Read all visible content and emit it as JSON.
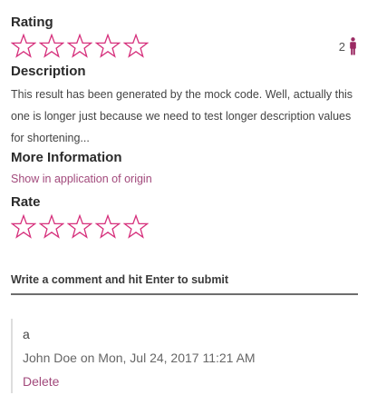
{
  "rating": {
    "heading": "Rating",
    "stars_filled": 0,
    "stars_total": 5,
    "count": "2",
    "count_icon": "person-icon"
  },
  "description": {
    "heading": "Description",
    "text": "This result has been generated by the mock code. Well, actually this one is longer just because we need to test longer description values for shortening..."
  },
  "more_info": {
    "heading": "More Information",
    "link_label": "Show in application of origin"
  },
  "rate": {
    "heading": "Rate",
    "stars_filled": 0,
    "stars_total": 5
  },
  "comment_form": {
    "placeholder": "Write a comment and hit Enter to submit",
    "value": ""
  },
  "comments": [
    {
      "text": "a",
      "meta": "John Doe on Mon, Jul 24, 2017 11:21 AM",
      "delete_label": "Delete"
    }
  ],
  "colors": {
    "accent": "#d6307c",
    "link": "#a24a7c",
    "underline": "#6d6d6d"
  }
}
